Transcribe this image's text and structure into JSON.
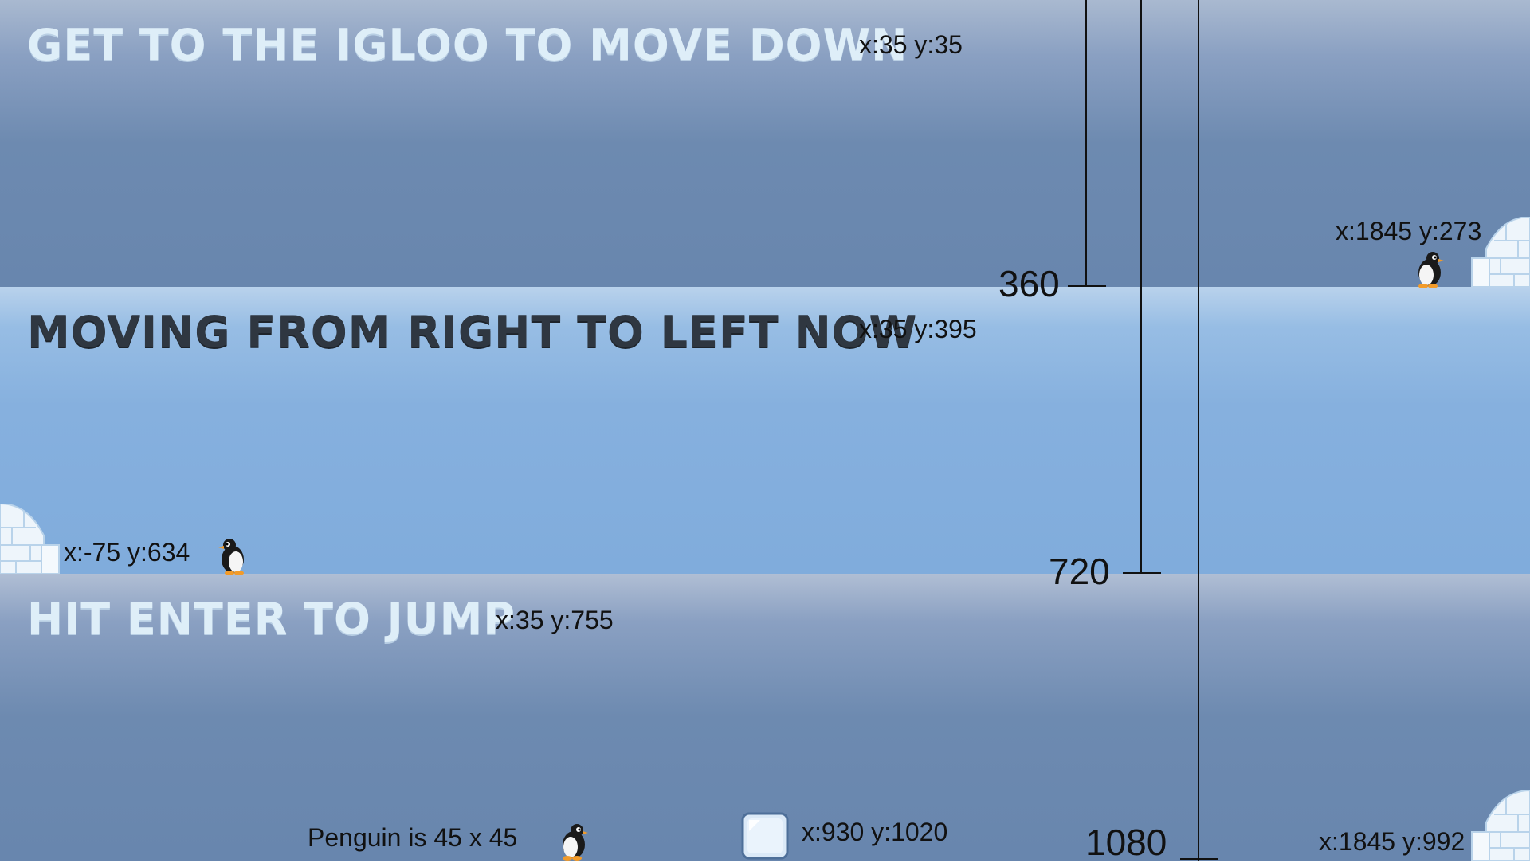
{
  "levels": [
    {
      "heading": "GET TO THE IGLOO TO MOVE DOWN",
      "heading_coord": "x:35 y:35",
      "igloo_coord": "x:1845 y:273"
    },
    {
      "heading": "MOVING FROM RIGHT TO LEFT NOW",
      "heading_coord": "x:35 y:395",
      "igloo_coord": "x:-75 y:634"
    },
    {
      "heading": "HIT ENTER TO JUMP",
      "heading_coord": "x:35 y:755",
      "igloo_coord": "x:1845 y:992"
    }
  ],
  "penguin_size_note": "Penguin is 45 x 45",
  "ice_block_coord": "x:930 y:1020",
  "scale_markers": [
    "360",
    "720",
    "1080"
  ],
  "colors": {
    "band_dark": "#6886ae",
    "band_light": "#80acdc",
    "heading_light": "#deeef8",
    "heading_dark": "#2f3741",
    "igloo": "#eef5fb"
  },
  "icons": [
    "penguin-icon",
    "igloo-icon",
    "ice-block-icon"
  ]
}
